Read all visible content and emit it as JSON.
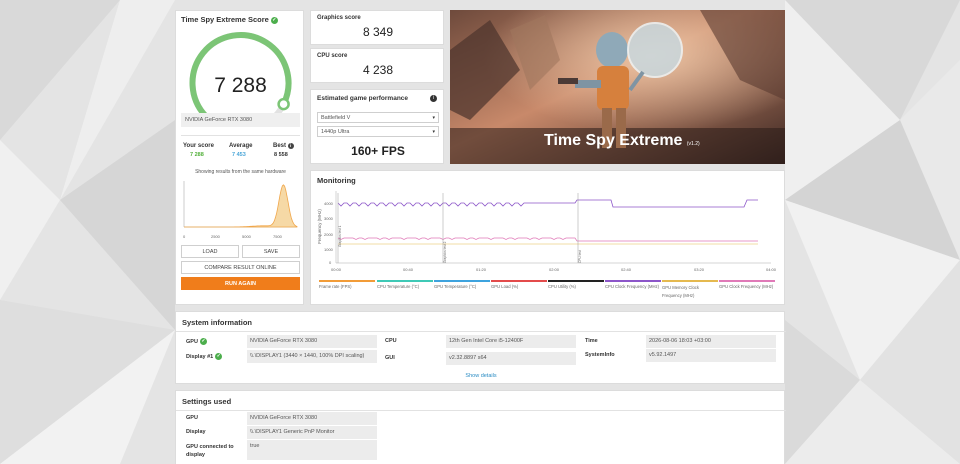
{
  "score_card": {
    "title": "Time Spy Extreme Score",
    "score": "7 288",
    "gpu_name": "NVIDIA GeForce RTX 3080",
    "gauge_fraction": 0.93,
    "your_score_label": "Your score",
    "your_score_value": "7 288",
    "average_label": "Average",
    "average_value": "7 453",
    "best_label": "Best",
    "best_value": "8 558",
    "histogram_note": "Showing results from the same hardware",
    "histogram_ticks": [
      "0",
      "2500",
      "5000",
      "7500"
    ],
    "load_label": "LOAD",
    "save_label": "SAVE",
    "compare_label": "COMPARE RESULT ONLINE",
    "run_again_label": "RUN AGAIN",
    "colors": {
      "accent": "#7cc576",
      "your": "#52b03a",
      "avg": "#4aa6d8",
      "run": "#f07d1b"
    }
  },
  "graphics_score": {
    "label": "Graphics score",
    "value": "8 349"
  },
  "cpu_score": {
    "label": "CPU score",
    "value": "4 238"
  },
  "game_perf": {
    "title": "Estimated game performance",
    "game": "Battlefield V",
    "preset": "1440p Ultra",
    "fps": "160+ FPS"
  },
  "hero": {
    "title": "Time Spy Extreme",
    "version": "(v1.2)"
  },
  "monitoring": {
    "title": "Monitoring",
    "y_label": "Frequency (MHz)",
    "y_ticks": [
      "4000",
      "3000",
      "2000",
      "1000",
      "0"
    ],
    "x_ticks": [
      "00:00",
      "00:40",
      "01:20",
      "02:00",
      "02:40",
      "03:20",
      "04:00"
    ],
    "markers": [
      "Graphics test 1",
      "Graphics test 2",
      "CPU test"
    ],
    "legend": [
      {
        "label": "Frame rate (FPS)",
        "color": "#f29c38"
      },
      {
        "label": "CPU Temperature (°C)",
        "color": "#3fc9b6"
      },
      {
        "label": "GPU Temperature (°C)",
        "color": "#3ea3de"
      },
      {
        "label": "GPU Load (%)",
        "color": "#e34b4b"
      },
      {
        "label": "CPU Utility (%)",
        "color": "#222222"
      },
      {
        "label": "CPU Clock Frequency (MHz)",
        "color": "#8c56c9"
      },
      {
        "label": "GPU Memory Clock Frequency (MHz)",
        "color": "#e5b94f"
      },
      {
        "label": "GPU Clock Frequency (MHz)",
        "color": "#e07ab8"
      }
    ]
  },
  "system_info": {
    "title": "System information",
    "gpu_label": "GPU",
    "gpu_value": "NVIDIA GeForce RTX 3080",
    "display_label": "Display #1",
    "display_value": "\\\\.\\DISPLAY1 (3440 × 1440, 100% DPI scaling)",
    "cpu_label": "CPU",
    "cpu_value": "12th Gen Intel Core i5-12400F",
    "gui_label": "GUI",
    "gui_value": "v2.32.8897 s64",
    "time_label": "Time",
    "time_value": "2026-08-06 18:03 +03:00",
    "sysinfo_label": "SystemInfo",
    "sysinfo_value": "v5.92.1497",
    "show_details": "Show details"
  },
  "settings_used": {
    "title": "Settings used",
    "gpu_label": "GPU",
    "gpu_value": "NVIDIA GeForce RTX 3080",
    "display_label": "Display",
    "display_value": "\\\\.\\DISPLAY1 Generic PnP Monitor",
    "connected_label": "GPU connected to display",
    "connected_value": "true"
  }
}
